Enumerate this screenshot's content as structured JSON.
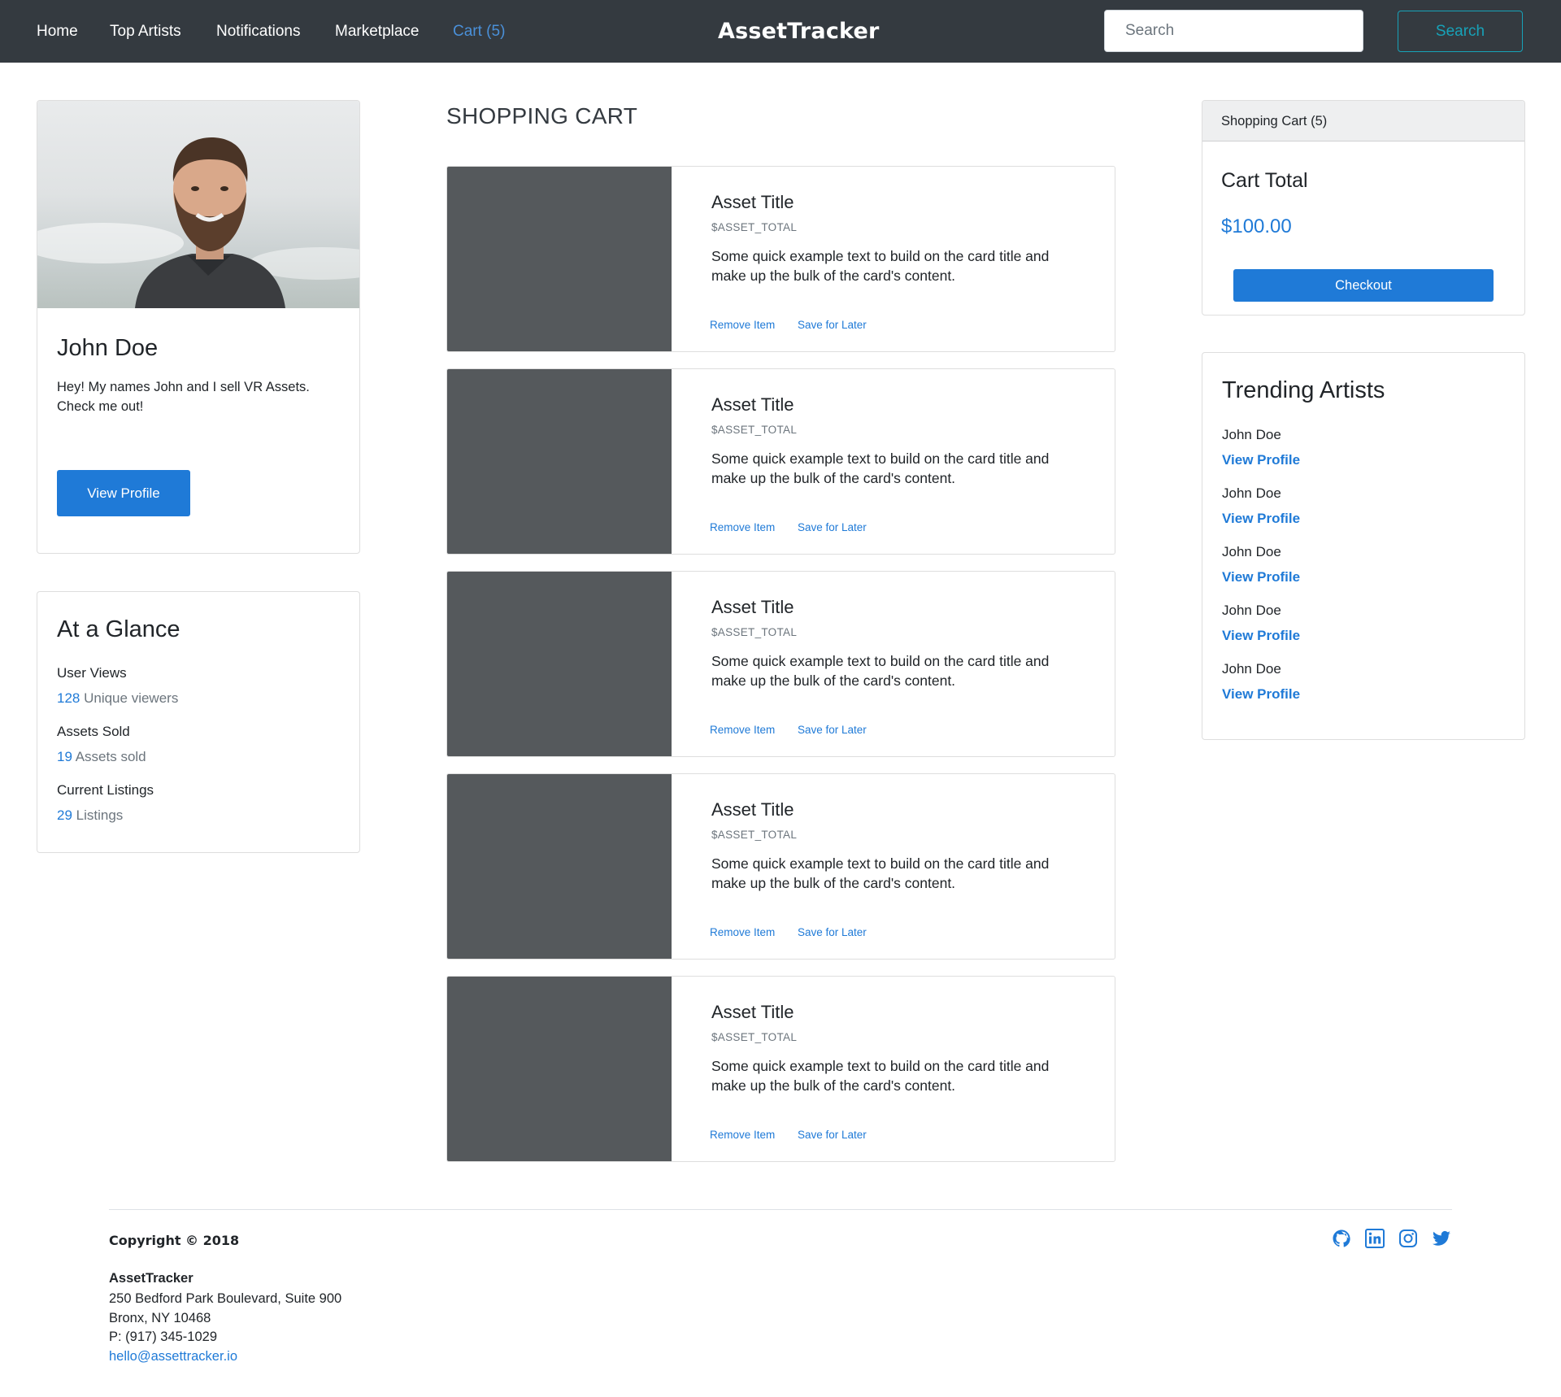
{
  "nav": {
    "links": [
      "Home",
      "Top Artists",
      "Notifications",
      "Marketplace",
      "Cart (5)"
    ],
    "brand": "AssetTracker",
    "search_placeholder": "Search",
    "search_button": "Search",
    "active_color": "#4a90d9"
  },
  "profile": {
    "name": "John Doe",
    "bio": "Hey! My names John and I sell VR Assets. Check me out!",
    "button": "View Profile"
  },
  "glance": {
    "title": "At a Glance",
    "stats": [
      {
        "label": "User Views",
        "number": "128",
        "suffix": " Unique viewers"
      },
      {
        "label": "Assets Sold",
        "number": "19",
        "suffix": " Assets sold"
      },
      {
        "label": "Current Listings",
        "number": "29",
        "suffix": " Listings"
      }
    ]
  },
  "cart": {
    "heading": "SHOPPING CART",
    "items": [
      {
        "title": "Asset Title",
        "price": "$ASSET_TOTAL",
        "text": "Some quick example text to build on the card title and make up the bulk of the card's content.",
        "remove": "Remove Item",
        "save": "Save for Later"
      },
      {
        "title": "Asset Title",
        "price": "$ASSET_TOTAL",
        "text": "Some quick example text to build on the card title and make up the bulk of the card's content.",
        "remove": "Remove Item",
        "save": "Save for Later"
      },
      {
        "title": "Asset Title",
        "price": "$ASSET_TOTAL",
        "text": "Some quick example text to build on the card title and make up the bulk of the card's content.",
        "remove": "Remove Item",
        "save": "Save for Later"
      },
      {
        "title": "Asset Title",
        "price": "$ASSET_TOTAL",
        "text": "Some quick example text to build on the card title and make up the bulk of the card's content.",
        "remove": "Remove Item",
        "save": "Save for Later"
      },
      {
        "title": "Asset Title",
        "price": "$ASSET_TOTAL",
        "text": "Some quick example text to build on the card title and make up the bulk of the card's content.",
        "remove": "Remove Item",
        "save": "Save for Later"
      }
    ]
  },
  "summary": {
    "header": "Shopping Cart (5)",
    "total_label": "Cart Total",
    "total_value": "$100.00",
    "checkout": "Checkout"
  },
  "trending": {
    "title": "Trending Artists",
    "artists": [
      {
        "name": "John Doe",
        "link": "View Profile"
      },
      {
        "name": "John Doe",
        "link": "View Profile"
      },
      {
        "name": "John Doe",
        "link": "View Profile"
      },
      {
        "name": "John Doe",
        "link": "View Profile"
      },
      {
        "name": "John Doe",
        "link": "View Profile"
      }
    ]
  },
  "footer": {
    "copyright": "Copyright © 2018",
    "company": "AssetTracker",
    "address1": "250 Bedford Park Boulevard, Suite 900",
    "address2": "Bronx, NY 10468",
    "phone": "P: (917) 345-1029",
    "email": "hello@assettracker.io",
    "social_icons": [
      "github-icon",
      "linkedin-icon",
      "instagram-icon",
      "twitter-icon"
    ]
  },
  "colors": {
    "navbar": "#343a40",
    "primary": "#1f7ad7",
    "outline_info": "#17a2b8",
    "thumbnail": "#55595c"
  }
}
